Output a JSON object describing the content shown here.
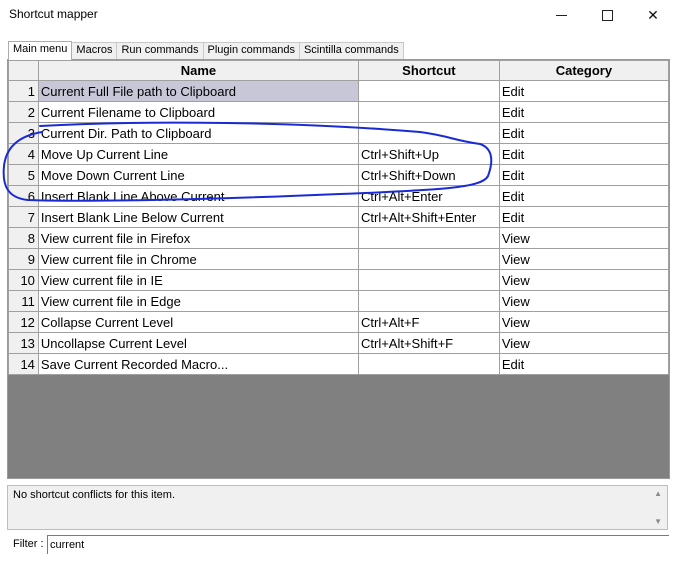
{
  "window": {
    "title": "Shortcut mapper",
    "minimize_symbol": "",
    "close_symbol": "✕"
  },
  "tabs": [
    {
      "label": "Main menu",
      "active": true
    },
    {
      "label": "Macros",
      "active": false
    },
    {
      "label": "Run commands",
      "active": false
    },
    {
      "label": "Plugin commands",
      "active": false
    },
    {
      "label": "Scintilla commands",
      "active": false
    }
  ],
  "table": {
    "headers": {
      "num": "",
      "name": "Name",
      "shortcut": "Shortcut",
      "category": "Category"
    },
    "rows": [
      {
        "num": "1",
        "name": "Current Full File path to Clipboard",
        "shortcut": "",
        "category": "Edit"
      },
      {
        "num": "2",
        "name": "Current Filename to Clipboard",
        "shortcut": "",
        "category": "Edit"
      },
      {
        "num": "3",
        "name": "Current Dir. Path to Clipboard",
        "shortcut": "",
        "category": "Edit"
      },
      {
        "num": "4",
        "name": "Move Up Current Line",
        "shortcut": "Ctrl+Shift+Up",
        "category": "Edit"
      },
      {
        "num": "5",
        "name": "Move Down Current Line",
        "shortcut": "Ctrl+Shift+Down",
        "category": "Edit"
      },
      {
        "num": "6",
        "name": "Insert Blank Line Above Current",
        "shortcut": "Ctrl+Alt+Enter",
        "category": "Edit"
      },
      {
        "num": "7",
        "name": "Insert Blank Line Below Current",
        "shortcut": "Ctrl+Alt+Shift+Enter",
        "category": "Edit"
      },
      {
        "num": "8",
        "name": "View current file in Firefox",
        "shortcut": "",
        "category": "View"
      },
      {
        "num": "9",
        "name": "View current file in Chrome",
        "shortcut": "",
        "category": "View"
      },
      {
        "num": "10",
        "name": "View current file in IE",
        "shortcut": "",
        "category": "View"
      },
      {
        "num": "11",
        "name": "View current file in Edge",
        "shortcut": "",
        "category": "View"
      },
      {
        "num": "12",
        "name": "Collapse Current Level",
        "shortcut": "Ctrl+Alt+F",
        "category": "View"
      },
      {
        "num": "13",
        "name": "Uncollapse Current Level",
        "shortcut": "Ctrl+Alt+Shift+F",
        "category": "View"
      },
      {
        "num": "14",
        "name": "Save Current Recorded Macro...",
        "shortcut": "",
        "category": "Edit"
      }
    ],
    "selected_row": 1
  },
  "conflicts": {
    "text": "No shortcut conflicts for this item."
  },
  "filter": {
    "label": "Filter :",
    "value": "current"
  },
  "colors": {
    "selected_row": "#c7c7d7",
    "grid_empty_area": "#808080",
    "annotation_ink": "#1a2bd6"
  }
}
